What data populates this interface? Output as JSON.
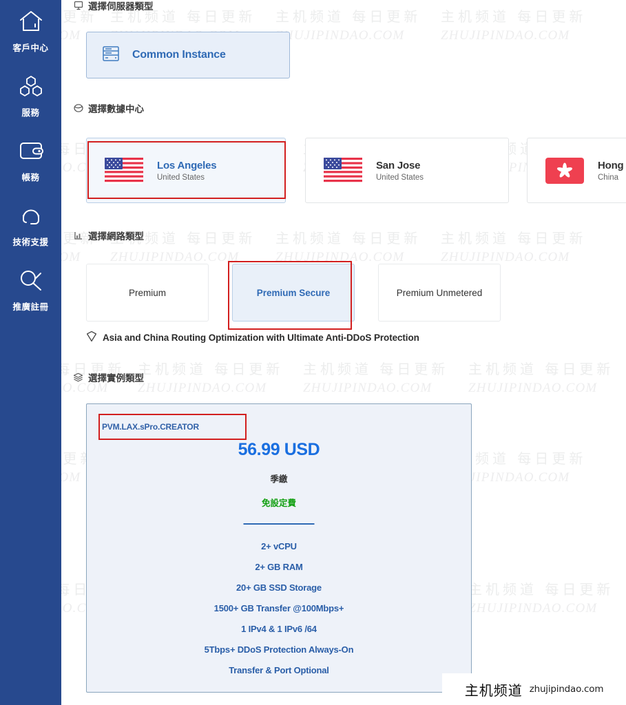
{
  "sidebar": {
    "items": [
      {
        "icon": "home-icon",
        "label": "客戶中心"
      },
      {
        "icon": "services-icon",
        "label": "服務"
      },
      {
        "icon": "wallet-icon",
        "label": "帳務"
      },
      {
        "icon": "headset-icon",
        "label": "技術支援"
      },
      {
        "icon": "affiliate-icon",
        "label": "推廣註冊"
      }
    ]
  },
  "server_type": {
    "heading": "選擇伺服器類型",
    "heading_icon": "server-monitor-icon",
    "options": [
      {
        "label": "Common Instance",
        "icon": "server-rack-icon",
        "selected": true
      }
    ]
  },
  "datacenter": {
    "heading": "選擇數據中心",
    "heading_icon": "globe-icon",
    "options": [
      {
        "name": "Los Angeles",
        "country": "United States",
        "flag": "us-flag-icon",
        "selected": true,
        "annotated": true
      },
      {
        "name": "San Jose",
        "country": "United States",
        "flag": "us-flag-icon",
        "selected": false,
        "annotated": false
      },
      {
        "name": "Hong Kong",
        "country": "China",
        "flag": "hk-flag-icon",
        "selected": false,
        "annotated": false
      }
    ]
  },
  "network_type": {
    "heading": "選擇網路類型",
    "heading_icon": "network-chart-icon",
    "options": [
      {
        "label": "Premium",
        "selected": false,
        "annotated": false
      },
      {
        "label": "Premium Secure",
        "selected": true,
        "annotated": true
      },
      {
        "label": "Premium Unmetered",
        "selected": false,
        "annotated": false
      }
    ],
    "note": "Asia and China Routing Optimization with Ultimate Anti-DDoS Protection",
    "note_icon": "shield-icon"
  },
  "instance_type": {
    "heading": "選擇實例類型",
    "heading_icon": "layers-icon",
    "card": {
      "name": "PVM.LAX.sPro.CREATOR",
      "annotated": true,
      "price": "56.99 USD",
      "billing_cycle": "季繳",
      "setup_fee": "免設定費",
      "specs": [
        "2+ vCPU",
        "2+ GB RAM",
        "20+ GB SSD Storage",
        "1500+ GB Transfer @100Mbps+",
        "1 IPv4 & 1 IPv6 /64",
        "5Tbps+ DDoS Protection Always-On",
        "Transfer & Port Optional"
      ]
    }
  },
  "watermark": {
    "cn": "主机频道 每日更新",
    "en": "ZHUJIPINDAO.COM"
  },
  "badge": {
    "cn": "主机频道",
    "en": "zhujipindao.com"
  },
  "colors": {
    "sidebar": "#27498e",
    "accent_blue": "#2f6ab5",
    "price_blue": "#1a6fe0",
    "green": "#14a014",
    "annotation_red": "#d21f1f"
  }
}
